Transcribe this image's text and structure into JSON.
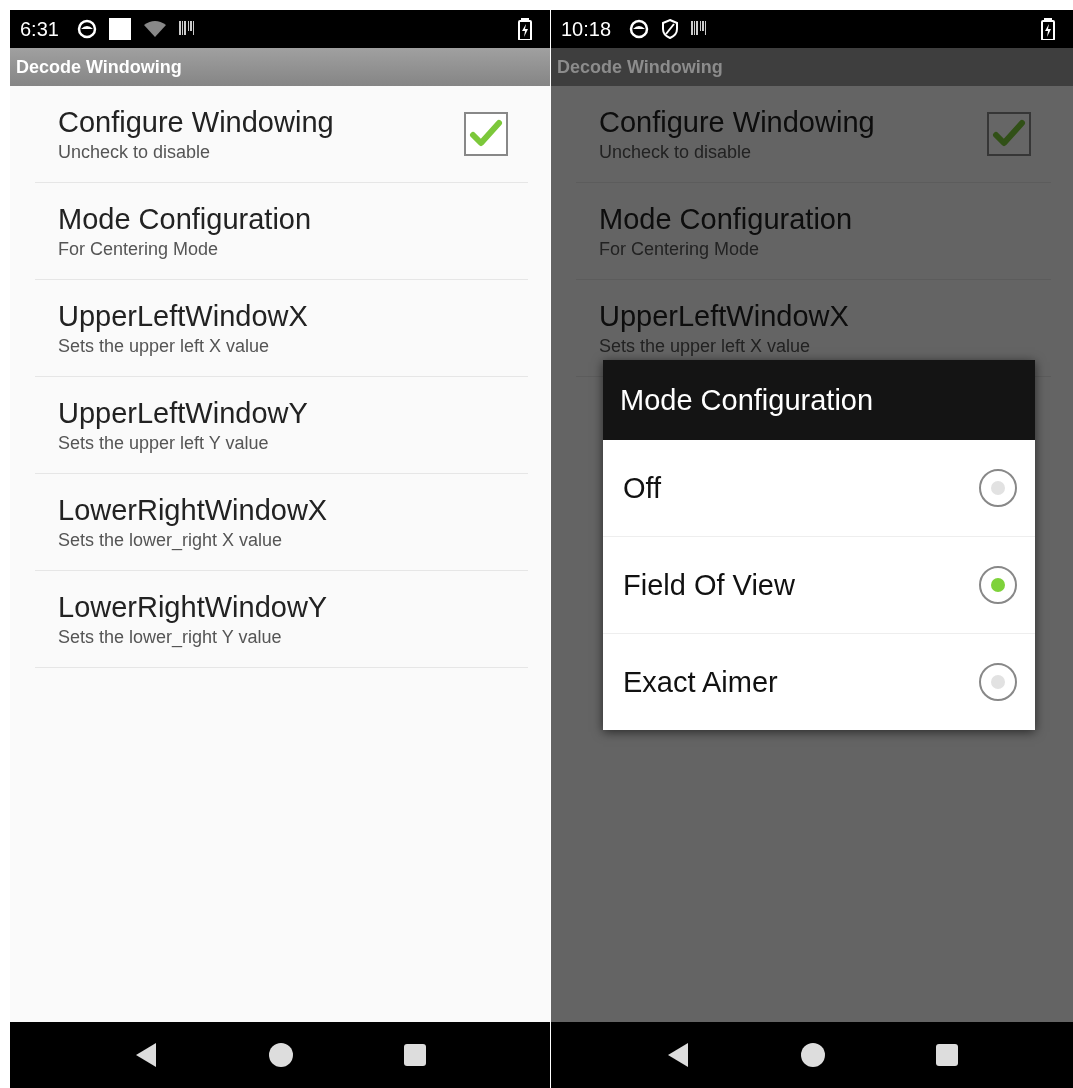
{
  "screens": [
    {
      "status_bar": {
        "time": "6:31"
      },
      "title_bar": {
        "title": "Decode Windowing"
      },
      "dimmed": false,
      "preferences": [
        {
          "title": "Configure Windowing",
          "summary": "Uncheck to disable",
          "kind": "checkbox",
          "checked": true
        },
        {
          "title": "Mode Configuration",
          "summary": "For Centering Mode",
          "kind": "plain"
        },
        {
          "title": "UpperLeftWindowX",
          "summary": "Sets the upper left X value",
          "kind": "plain"
        },
        {
          "title": "UpperLeftWindowY",
          "summary": "Sets the upper left Y value",
          "kind": "plain"
        },
        {
          "title": "LowerRightWindowX",
          "summary": "Sets the lower_right X value",
          "kind": "plain"
        },
        {
          "title": "LowerRightWindowY",
          "summary": "Sets the lower_right Y value",
          "kind": "plain"
        }
      ]
    },
    {
      "status_bar": {
        "time": "10:18"
      },
      "title_bar": {
        "title": "Decode Windowing"
      },
      "dimmed": true,
      "preferences": [
        {
          "title": "Configure Windowing",
          "summary": "Uncheck to disable",
          "kind": "checkbox",
          "checked": true
        },
        {
          "title": "Mode Configuration",
          "summary": "For Centering Mode",
          "kind": "plain"
        },
        {
          "title": "UpperLeftWindowX",
          "summary": "Sets the upper left X value",
          "kind": "plain"
        }
      ],
      "dialog": {
        "title": "Mode Configuration",
        "options": [
          {
            "label": "Off",
            "selected": false
          },
          {
            "label": "Field Of View",
            "selected": true
          },
          {
            "label": "Exact Aimer",
            "selected": false
          }
        ]
      }
    }
  ]
}
